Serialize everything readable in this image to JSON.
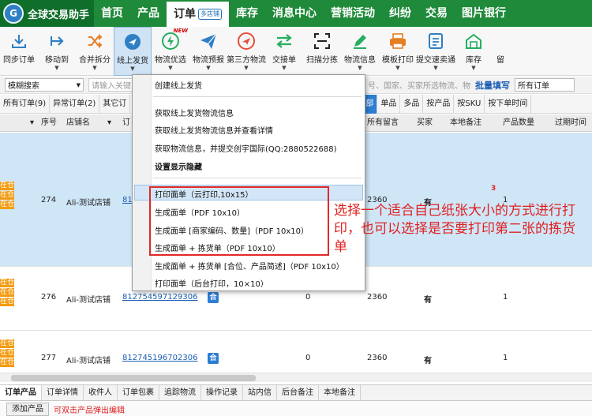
{
  "app": {
    "logo_letter": "G",
    "name": "全球交易助手"
  },
  "nav": {
    "items": [
      "首页",
      "产品"
    ],
    "active": {
      "label": "订单",
      "tag": "多店铺"
    },
    "items_after": [
      "库存",
      "消息中心",
      "营销活动",
      "纠纷",
      "交易",
      "图片银行"
    ]
  },
  "toolbar": {
    "new_badge": "NEW",
    "items": [
      {
        "label": "同步订单",
        "icon": "download-icon",
        "color": "#2f7fc4"
      },
      {
        "label": "移动到",
        "icon": "move-icon",
        "color": "#2f7fc4"
      },
      {
        "label": "合并拆分",
        "icon": "shuffle-icon",
        "color": "#e67e22"
      },
      {
        "label": "线上发货",
        "icon": "plane-icon",
        "color": "#2f7fc4"
      },
      {
        "label": "物流优选",
        "icon": "bolt-icon",
        "color": "#27ae60"
      },
      {
        "label": "物流预报",
        "icon": "paper-plane-icon",
        "color": "#2f7fc4"
      },
      {
        "label": "第三方物流",
        "icon": "plane-circle-icon",
        "color": "#e74c3c"
      },
      {
        "label": "交接单",
        "icon": "swap-icon",
        "color": "#27ae60"
      },
      {
        "label": "扫描分拣",
        "icon": "scan-icon",
        "color": "#222222"
      },
      {
        "label": "物流信息",
        "icon": "edit-icon",
        "color": "#27ae60"
      },
      {
        "label": "模板打印",
        "icon": "printer-icon",
        "color": "#e67e22"
      },
      {
        "label": "提交速卖通",
        "icon": "form-icon",
        "color": "#2f7fc4"
      },
      {
        "label": "库存",
        "icon": "warehouse-icon",
        "color": "#27ae60"
      },
      {
        "label": "留",
        "icon": "",
        "color": "#222222"
      }
    ]
  },
  "filter": {
    "mode": "模糊搜索",
    "search_placeholder": "请输入关键",
    "right_text": "号、国家、买家所选物流、物流",
    "batch": "批量填写",
    "scope": "所有订单"
  },
  "status_tabs": {
    "left": [
      "所有订单(9)",
      "异常订单(2)",
      "其它订"
    ],
    "right_active": "全部",
    "right": [
      "单品",
      "多品",
      "按产品",
      "按SKU",
      "按下单时间"
    ]
  },
  "table": {
    "headers": [
      "序号",
      "店铺名",
      "订",
      "所有留言",
      "买家",
      "本地备注",
      "产品数量",
      "过期时间"
    ],
    "side_badges": [
      "在仓",
      "在仓",
      "在仓"
    ],
    "rows": [
      {
        "seq": "274",
        "store": "Ali-测试店铺",
        "order": "81",
        "count": "2360",
        "buyer": "有",
        "mark": "3",
        "qty": "1"
      },
      {
        "seq": "276",
        "store": "Ali-测试店铺",
        "order": "812754597129306",
        "tag": "合",
        "zero": "0",
        "count": "2360",
        "buyer": "有",
        "qty": "1"
      },
      {
        "seq": "277",
        "store": "Ali-测试店铺",
        "order": "812745196702306",
        "tag": "合",
        "zero": "0",
        "count": "2360",
        "buyer": "有",
        "qty": "1"
      }
    ]
  },
  "menu": {
    "items": [
      {
        "label": "创建线上发货",
        "bold": false
      },
      {
        "label": "获取线上发货物流信息",
        "bold": false
      },
      {
        "label": "获取线上发货物流信息并查看详情",
        "bold": false
      },
      {
        "label": "获取物流信息，并提交创宇国际(QQ:2880522688)",
        "bold": false
      },
      {
        "label": "设置显示隐藏",
        "bold": true
      },
      {
        "label": "打印面单（云打印,10x15）",
        "bold": false
      },
      {
        "label": "生成面单（PDF 10x10）",
        "bold": false
      },
      {
        "label": "生成面单 [商家编码、数量]（PDF 10x10）",
        "bold": false
      },
      {
        "label": "生成面单 + 拣货单（PDF 10x10）",
        "bold": false
      },
      {
        "label": "生成面单 + 拣货单 [合位、产品简述]（PDF 10x10）",
        "bold": false
      },
      {
        "label": "打印面单（后台打印，10×10）",
        "bold": false
      }
    ]
  },
  "annotation": "选择一个适合自己纸张大小的方式进行打印，也可以选择是否要打印第二张的拣货单",
  "bottom_tabs": [
    "订单产品",
    "订单详情",
    "收件人",
    "订单包裹",
    "追踪物流",
    "操作记录",
    "站内信",
    "后台备注",
    "本地备注"
  ],
  "bottom_bar": {
    "add_button": "添加产品",
    "hint": "可双击产品弹出编辑"
  }
}
